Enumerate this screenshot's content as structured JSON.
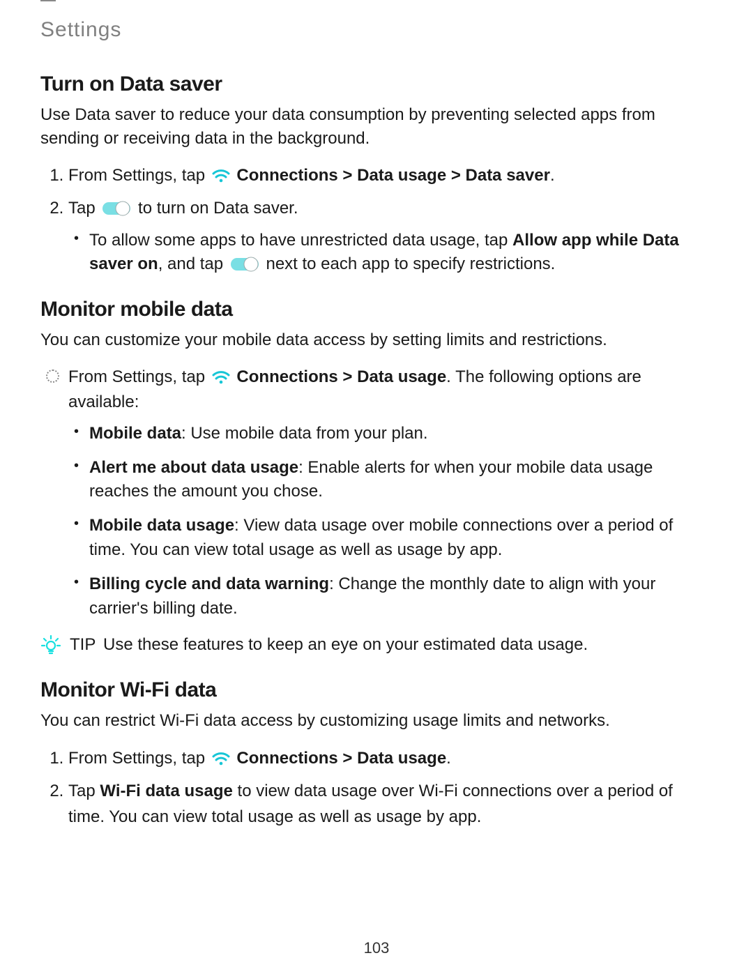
{
  "header": {
    "title": "Settings"
  },
  "pageNumber": "103",
  "section1": {
    "heading": "Turn on Data saver",
    "lead": "Use Data saver to reduce your data consumption by preventing selected apps from sending or receiving data in the background.",
    "step1_pre": "From Settings, tap ",
    "step1_bold": "Connections > Data usage > Data saver",
    "step1_post": ".",
    "step2_pre": "Tap ",
    "step2_post": " to turn on Data saver.",
    "sub1_pre": "To allow some apps to have unrestricted data usage, tap ",
    "sub1_bold": "Allow app while Data saver on",
    "sub1_mid": ", and tap ",
    "sub1_post": " next to each app to specify restrictions."
  },
  "section2": {
    "heading": "Monitor mobile data",
    "lead": "You can customize your mobile data access by setting limits and restrictions.",
    "main_pre": "From Settings, tap ",
    "main_bold": "Connections > Data usage",
    "main_post": ". The following options are available:",
    "opt1_bold": "Mobile data",
    "opt1_rest": ": Use mobile data from your plan.",
    "opt2_bold": "Alert me about data usage",
    "opt2_rest": ": Enable alerts for when your mobile data usage reaches the amount you chose.",
    "opt3_bold": "Mobile data usage",
    "opt3_rest": ": View data usage over mobile connections over a period of time. You can view total usage as well as usage by app.",
    "opt4_bold": "Billing cycle and data warning",
    "opt4_rest": ": Change the monthly date to align with your carrier's billing date.",
    "tip_label": "TIP",
    "tip_text": "Use these features to keep an eye on your estimated data usage."
  },
  "section3": {
    "heading": "Monitor Wi-Fi data",
    "lead": "You can restrict Wi-Fi data access by customizing usage limits and networks.",
    "step1_pre": "From Settings, tap ",
    "step1_bold": "Connections > Data usage",
    "step1_post": ".",
    "step2_pre": "Tap ",
    "step2_bold": "Wi-Fi data usage",
    "step2_post": " to view data usage over Wi-Fi connections over a period of time. You can view total usage as well as usage by app."
  }
}
